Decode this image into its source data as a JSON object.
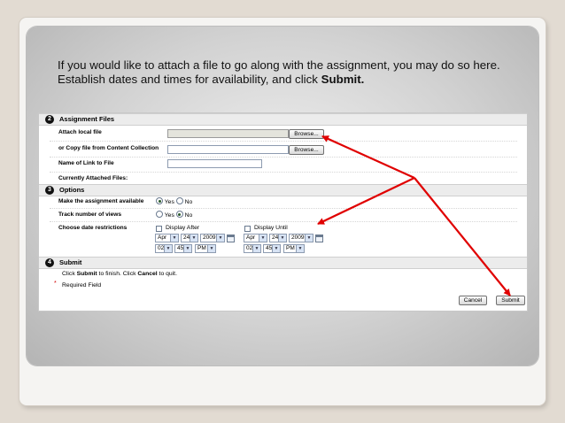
{
  "caption": {
    "text": "If you would like to attach a file to go along with the assignment, you may do so here.  Establish dates and times for availability, and click ",
    "bold": "Submit."
  },
  "section2": {
    "number": "2",
    "title": "Assignment Files",
    "attach_label": "Attach local file",
    "copy_label": "or Copy file from Content Collection",
    "link_name_label": "Name of Link to File",
    "current_files_label": "Currently Attached Files:",
    "browse_label": "Browse..."
  },
  "section3": {
    "number": "3",
    "title": "Options",
    "available_label": "Make the assignment available",
    "track_label": "Track number of views",
    "dates_label": "Choose date restrictions",
    "yes_label": "Yes",
    "no_label": "No",
    "available_value": "Yes",
    "track_value": "No",
    "display_after_label": "Display After",
    "display_until_label": "Display Until",
    "after": {
      "month": "Apr",
      "day": "24",
      "year": "2009",
      "hour": "02",
      "minute": "45",
      "ampm": "PM"
    },
    "until": {
      "month": "Apr",
      "day": "24",
      "year": "2009",
      "hour": "02",
      "minute": "45",
      "ampm": "PM"
    }
  },
  "section4": {
    "number": "4",
    "title": "Submit",
    "instruction_prefix": "Click ",
    "instruction_submit": "Submit",
    "instruction_middle": " to finish. Click ",
    "instruction_cancel": "Cancel",
    "instruction_suffix": " to quit.",
    "required_star": "*",
    "required_label": "Required Field",
    "cancel_label": "Cancel",
    "submit_label": "Submit"
  },
  "colors": {
    "arrow": "#e00000",
    "section_header": "#ececec",
    "background": "#e2dbd2"
  }
}
